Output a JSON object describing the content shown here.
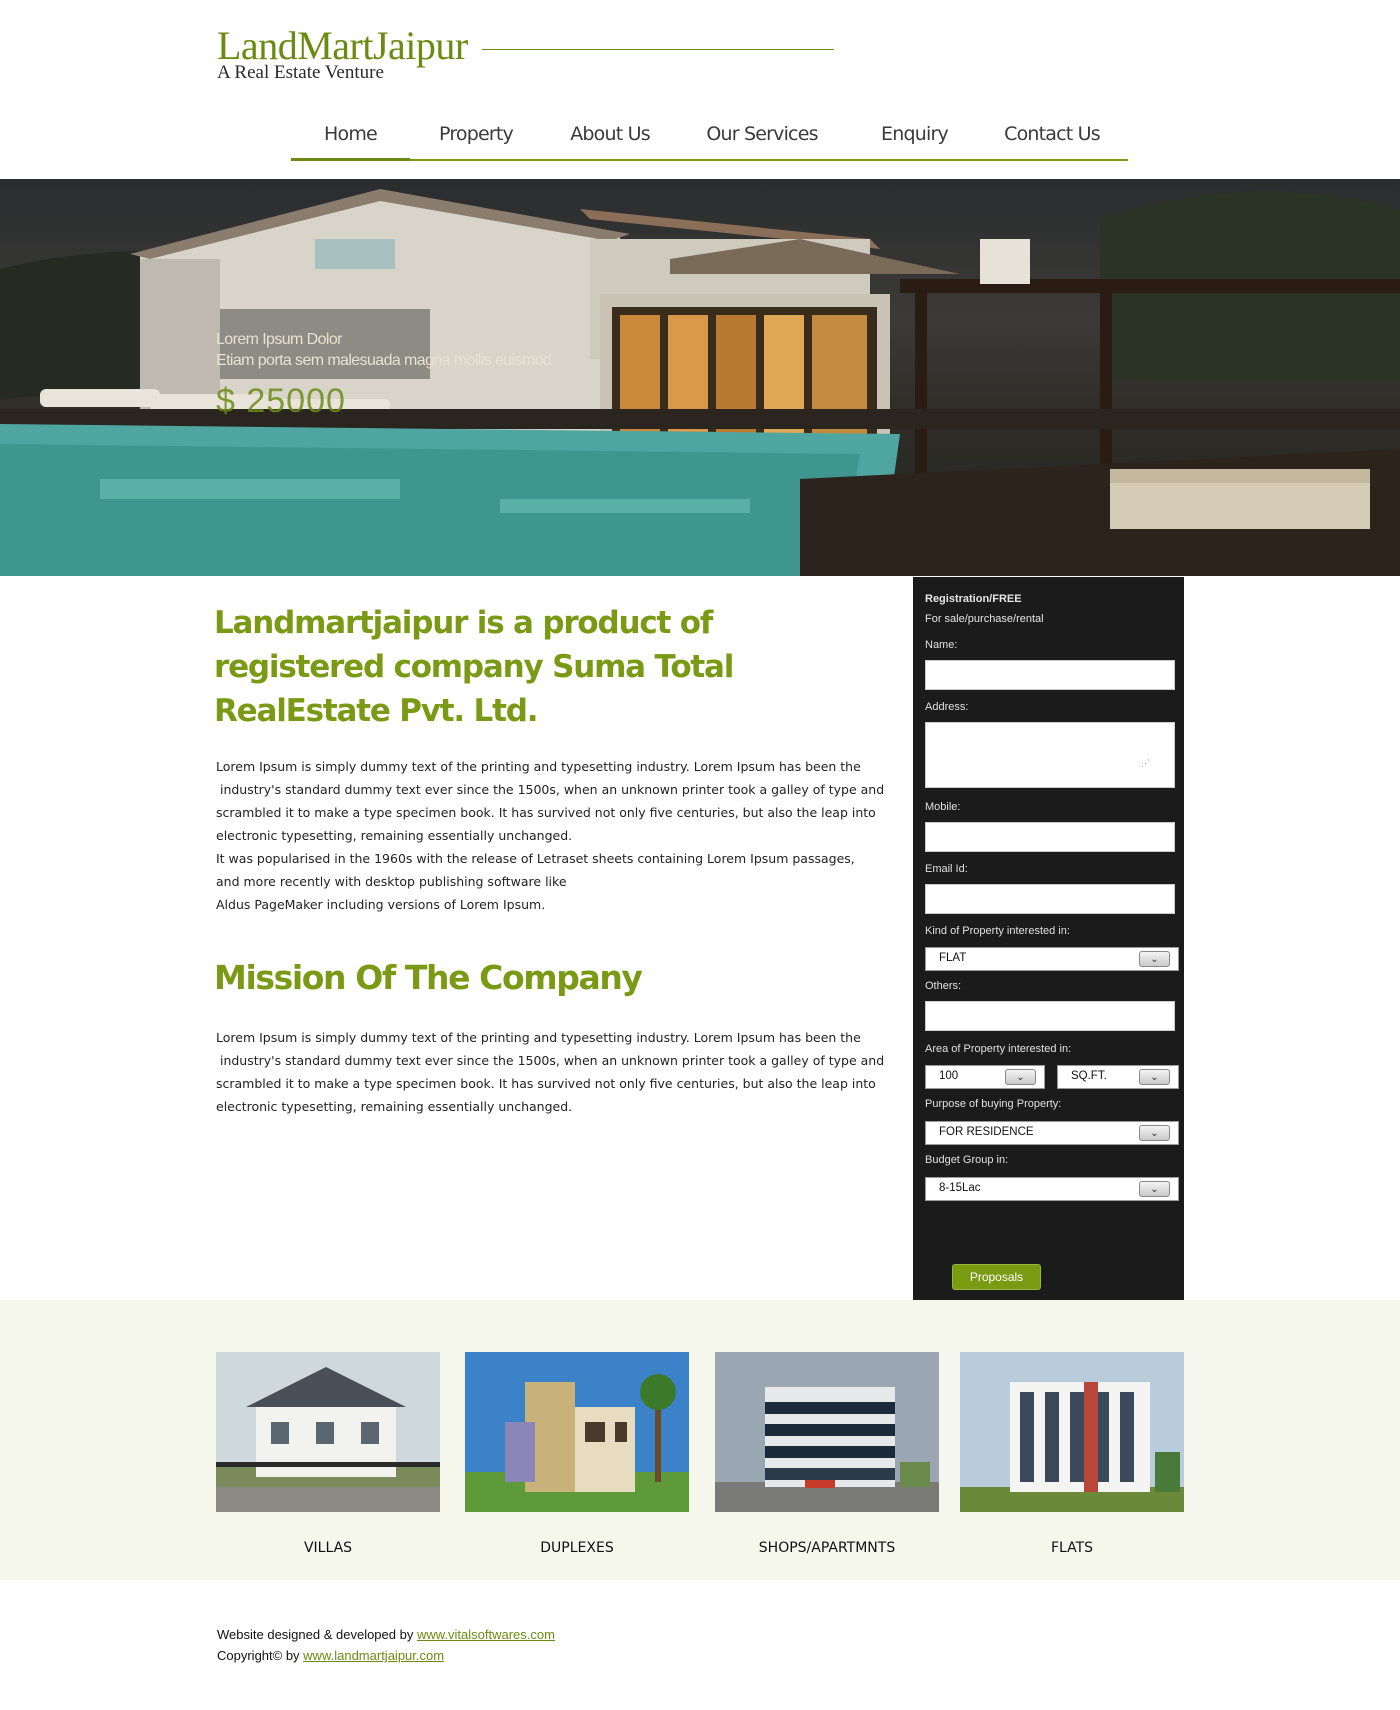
{
  "brand": {
    "title": "LandMartJaipur",
    "tagline": "A Real Estate Venture"
  },
  "nav": {
    "items": [
      {
        "label": "Home",
        "active": true
      },
      {
        "label": "Property",
        "active": false
      },
      {
        "label": "About Us",
        "active": false
      },
      {
        "label": "Our Services",
        "active": false
      },
      {
        "label": "Enquiry",
        "active": false
      },
      {
        "label": "Contact Us",
        "active": false
      }
    ]
  },
  "hero": {
    "line1": "Lorem Ipsum Dolor",
    "line2": "Etiam porta sem malesuada magna mollis euismod",
    "price": "$ 25000"
  },
  "main": {
    "title": "Landmartjaipur is a product of registered company Suma Total RealEstate Pvt. Ltd.",
    "intro_lines": [
      "Lorem Ipsum is simply dummy text of the printing and typesetting industry. Lorem Ipsum has been the",
      " industry's standard dummy text ever since the 1500s, when an unknown printer took a galley of type and",
      "scrambled it to make a type specimen book. It has survived not only five centuries, but also the leap into",
      "electronic typesetting, remaining essentially unchanged.",
      "It was popularised in the 1960s with the release of Letraset sheets containing Lorem Ipsum passages,",
      "and more recently with desktop publishing software like",
      "Aldus PageMaker including versions of Lorem Ipsum."
    ],
    "mission_title": "Mission Of The Company",
    "mission_lines": [
      "Lorem Ipsum is simply dummy text of the printing and typesetting industry. Lorem Ipsum has been the",
      " industry's standard dummy text ever since the 1500s, when an unknown printer took a galley of type and",
      "scrambled it to make a type specimen book. It has survived not only five centuries, but also the leap into",
      "electronic typesetting, remaining essentially unchanged."
    ]
  },
  "form": {
    "title": "Registration/FREE",
    "subtitle": "For sale/purchase/rental",
    "name_label": "Name:",
    "address_label": "Address:",
    "mobile_label": "Mobile:",
    "email_label": "Email Id:",
    "kind_label": "Kind of Property interested in:",
    "kind_value": "FLAT",
    "others_label": "Others:",
    "area_label": "Area of Property interested in:",
    "area_value": "100",
    "area_unit": "SQ.FT.",
    "purpose_label": "Purpose of buying Property:",
    "purpose_value": "FOR RESIDENCE",
    "budget_label": "Budget Group in:",
    "budget_value": "8-15Lac",
    "submit_label": "Proposals"
  },
  "properties": [
    {
      "label": "VILLAS"
    },
    {
      "label": "DUPLEXES"
    },
    {
      "label": "SHOPS/APARTMNTS"
    },
    {
      "label": "FLATS"
    }
  ],
  "footer": {
    "line1_text": "Website designed & developed by ",
    "line1_link": "www.vitalsoftwares.com",
    "line2_text": "Copyright© by ",
    "line2_link": "www.landmartjaipur.com"
  },
  "colors": {
    "accent": "#7a9a15",
    "form_bg": "#1b1b1b",
    "band_bg": "#f5f6ec"
  }
}
